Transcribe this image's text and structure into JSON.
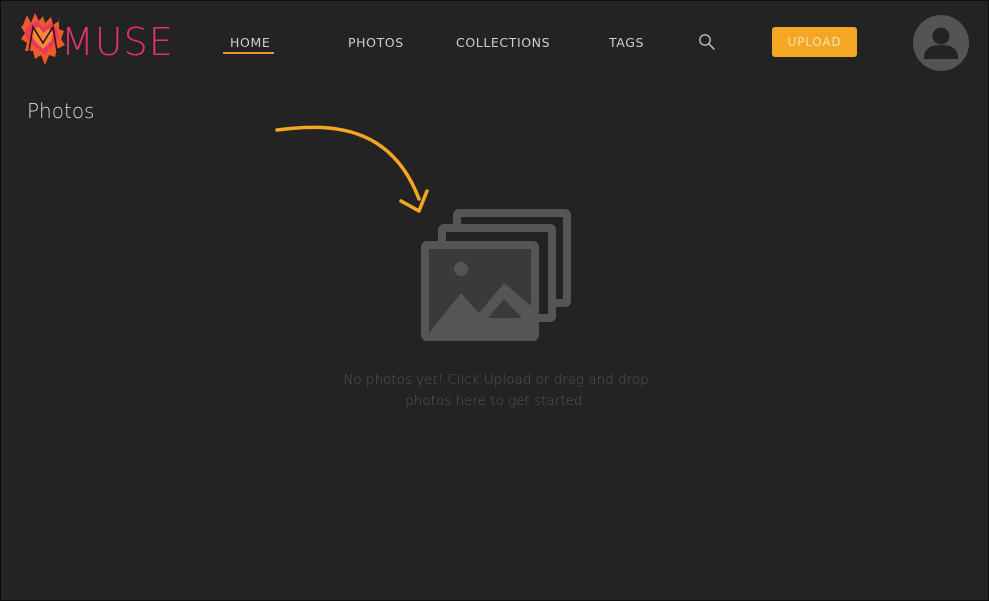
{
  "app": {
    "name": "MUSE",
    "logo_icon": "heart-splash-logo",
    "brand_color": "#e0336c",
    "accent_color": "#f5a623"
  },
  "nav": {
    "items": [
      {
        "label": "HOME",
        "active": true
      },
      {
        "label": "PHOTOS",
        "active": false
      },
      {
        "label": "COLLECTIONS",
        "active": false
      },
      {
        "label": "TAGS",
        "active": false
      }
    ],
    "search_icon": "search-icon",
    "upload_label": "UPLOAD",
    "avatar_icon": "user-avatar-icon"
  },
  "page": {
    "title": "Photos",
    "empty_state": {
      "icon": "photo-stack-icon",
      "pointer": "curved-arrow-icon",
      "message": "No photos yet! Click Upload or drag and drop photos here to get started."
    }
  }
}
